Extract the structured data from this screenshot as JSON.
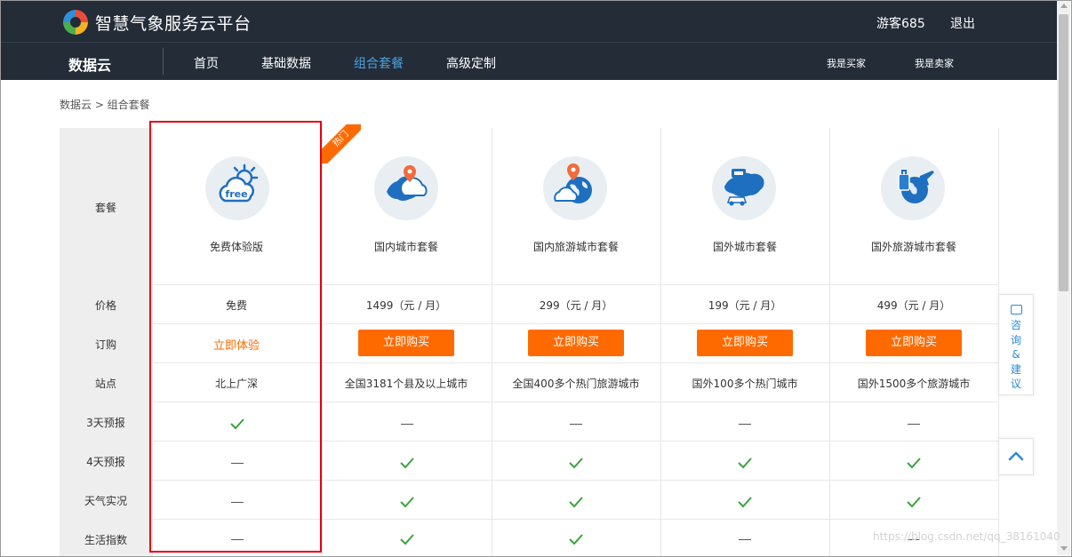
{
  "header": {
    "brand": "智慧气象服务云平台",
    "user": "游客685",
    "logout": "退出"
  },
  "nav": {
    "title": "数据云",
    "items": [
      "首页",
      "基础数据",
      "组合套餐",
      "高级定制"
    ],
    "active": "组合套餐",
    "right": [
      "我是买家",
      "我是卖家"
    ]
  },
  "breadcrumb": "数据云 > 组合套餐",
  "table": {
    "row_labels": [
      "套餐",
      "价格",
      "订购",
      "站点",
      "3天预报",
      "4天预报",
      "天气实况",
      "生活指数"
    ],
    "hot_badge": "热门",
    "packages": [
      {
        "name": "免费体验版",
        "price": "免费",
        "action": "立即体验",
        "site": "北上广深",
        "features": [
          "check",
          "dash",
          "dash",
          "dash"
        ]
      },
      {
        "name": "国内城市套餐",
        "price": "1499（元 / 月）",
        "action": "立即购买",
        "site": "全国3181个县及以上城市",
        "features": [
          "dash",
          "check",
          "check",
          "check"
        ]
      },
      {
        "name": "国内旅游城市套餐",
        "price": "299（元 / 月）",
        "action": "立即购买",
        "site": "全国400多个热门旅游城市",
        "features": [
          "dash",
          "check",
          "check",
          "check"
        ]
      },
      {
        "name": "国外城市套餐",
        "price": "199（元 / 月）",
        "action": "立即购买",
        "site": "国外100多个热门城市",
        "features": [
          "dash",
          "check",
          "check",
          "dash"
        ]
      },
      {
        "name": "国外旅游城市套餐",
        "price": "499（元 / 月）",
        "action": "立即购买",
        "site": "国外1500多个旅游城市",
        "features": [
          "dash",
          "check",
          "check",
          "dash"
        ]
      }
    ]
  },
  "side": {
    "consult": "咨询&建议",
    "consult_chars": [
      "咨",
      "询",
      "&",
      "建",
      "议"
    ]
  },
  "watermark": "https://blog.csdn.net/qq_38161040",
  "colors": {
    "header_bg": "#232c37",
    "accent": "#ff6a00",
    "active_nav": "#4aa3e0",
    "check": "#3aa53a",
    "highlight": "#e60012",
    "side_blue": "#2d8bd6"
  },
  "icons": [
    "free-weather-icon",
    "china-map-pin-icon",
    "globe-pin-icon",
    "world-map-car-icon",
    "globe-luggage-plane-icon"
  ]
}
